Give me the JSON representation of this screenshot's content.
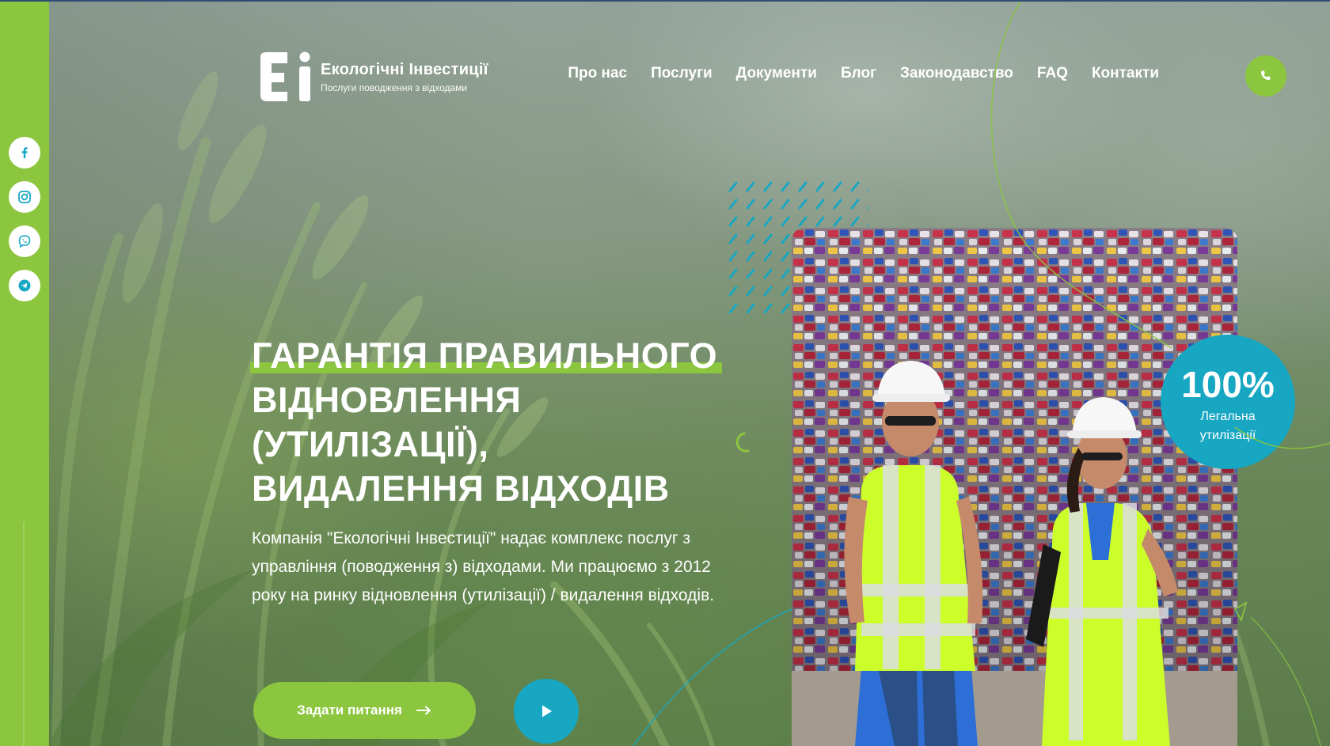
{
  "header": {
    "logo": {
      "mark": "Ei",
      "title": "Екологічні Інвестиції",
      "subtitle": "Послуги поводження з відходами"
    },
    "nav": [
      {
        "label": "Про нас"
      },
      {
        "label": "Послуги"
      },
      {
        "label": "Документи"
      },
      {
        "label": "Блог"
      },
      {
        "label": "Законодавство"
      },
      {
        "label": "FAQ"
      },
      {
        "label": "Контакти"
      }
    ],
    "phone_icon": "phone-icon"
  },
  "social": [
    {
      "name": "facebook-icon"
    },
    {
      "name": "instagram-icon"
    },
    {
      "name": "viber-icon"
    },
    {
      "name": "telegram-icon"
    }
  ],
  "hero": {
    "title_lines": [
      "ГАРАНТІЯ ПРАВИЛЬНОГО",
      "ВІДНОВЛЕННЯ",
      "(УТИЛІЗАЦІЇ),",
      "ВИДАЛЕННЯ ВІДХОДІВ"
    ],
    "description": "Компанія \"Екологічні Інвестиції\" надає комплекс послуг з управління (поводження з) відходами. Ми працюємо з 2012 року на ринку відновлення (утилізації) / видалення відходів.",
    "cta_label": "Задати питання",
    "cta_icon": "arrow-right-icon",
    "play_icon": "play-icon"
  },
  "badge": {
    "value": "100%",
    "label_line1": "Легальна",
    "label_line2": "утилізації"
  },
  "colors": {
    "accent_green": "#8cc63f",
    "accent_teal": "#17a7c2",
    "text_white": "#ffffff"
  }
}
